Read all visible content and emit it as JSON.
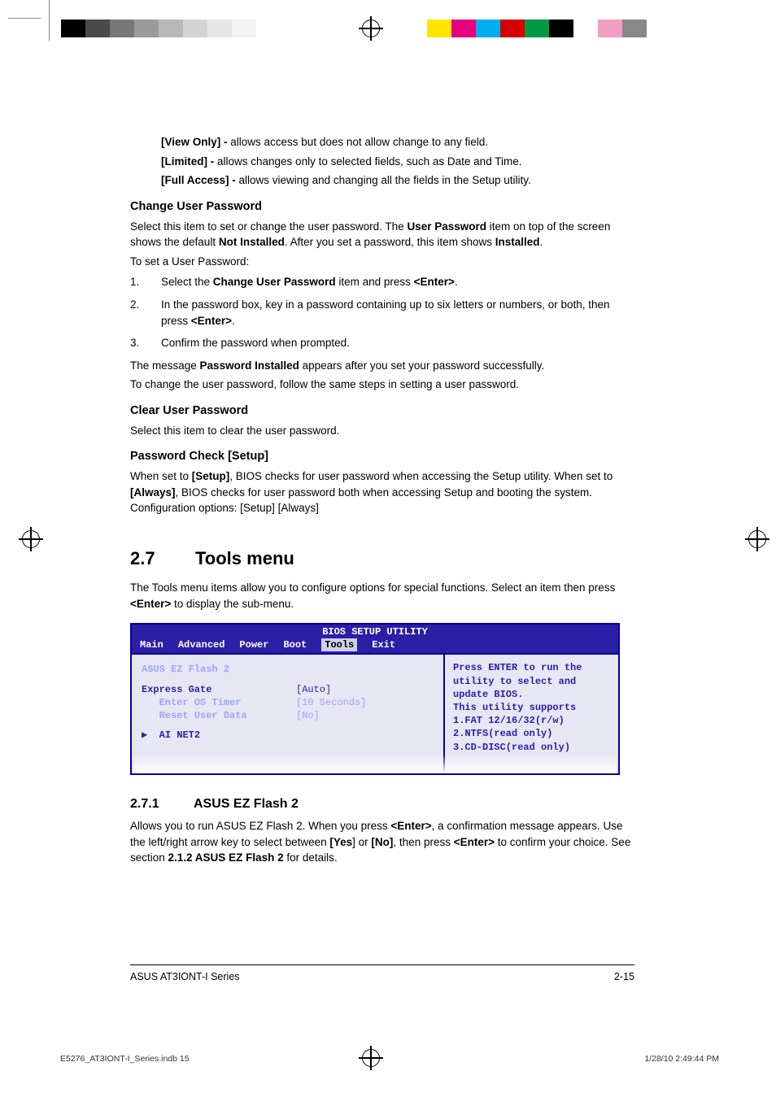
{
  "access_levels": [
    {
      "label": "[View Only] - ",
      "desc": "allows access but does not allow change to any field."
    },
    {
      "label": "[Limited] - ",
      "desc": "allows changes only to selected fields, such as Date and Time."
    },
    {
      "label": "[Full Access] - ",
      "desc": "allows viewing and changing all the fields in the Setup utility."
    }
  ],
  "change_pw": {
    "heading": "Change User Password",
    "p1a": "Select this item to set or change the user password. The ",
    "p1b": "User Password",
    "p1c": " item on top of the screen shows the default ",
    "p1d": "Not Installed",
    "p1e": ". After you set a password, this item shows ",
    "p1f": "Installed",
    "p1g": ".",
    "p2": "To set a User Password:",
    "steps": [
      {
        "n": "1.",
        "pre": "Select the ",
        "b1": "Change User Password",
        "mid": " item and press ",
        "b2": "<Enter>",
        "post": "."
      },
      {
        "n": "2.",
        "pre": "In the password box, key in a password containing up to six letters or numbers, or both, then press ",
        "b1": "<Enter>",
        "mid": "",
        "b2": "",
        "post": "."
      },
      {
        "n": "3.",
        "pre": "Confirm the password when prompted.",
        "b1": "",
        "mid": "",
        "b2": "",
        "post": ""
      }
    ],
    "p3a": "The message ",
    "p3b": "Password Installed",
    "p3c": " appears after you set your password successfully.",
    "p4": "To change the user password, follow the same steps in setting a user password."
  },
  "clear_pw": {
    "heading": "Clear User Password",
    "p1": "Select this item to clear the user password."
  },
  "pw_check": {
    "heading": "Password Check [Setup]",
    "p1a": "When set to ",
    "p1b": "[Setup]",
    "p1c": ", BIOS checks for user password when accessing the Setup utility. When set to ",
    "p1d": "[Always]",
    "p1e": ", BIOS checks for user password both when accessing Setup and booting the system. Configuration options: [Setup] [Always]"
  },
  "section": {
    "num": "2.7",
    "title": "Tools menu",
    "intro_a": "The Tools menu items allow you to configure options for special functions. Select an item then press ",
    "intro_b": "<Enter>",
    "intro_c": " to display the sub-menu."
  },
  "bios": {
    "title": "BIOS SETUP UTILITY",
    "menus": [
      "Main",
      "Advanced",
      "Power",
      "Boot",
      "Tools",
      "Exit"
    ],
    "selected": "Tools",
    "left": {
      "line1": "ASUS EZ Flash 2",
      "rows": [
        {
          "lbl": "Express Gate",
          "val": "[Auto]"
        },
        {
          "lbl": "   Enter OS Timer",
          "val": "[10 Seconds]"
        },
        {
          "lbl": "   Reset User Data",
          "val": "[No]"
        }
      ],
      "submenu": "AI NET2"
    },
    "right": "Press ENTER to run the utility to select and update BIOS.\nThis utility supports\n1.FAT 12/16/32(r/w)\n2.NTFS(read only)\n3.CD-DISC(read only)"
  },
  "subsection": {
    "num": "2.7.1",
    "title": "ASUS EZ Flash 2",
    "p_a": "Allows you to run ASUS EZ Flash 2. When you press ",
    "p_b": "<Enter>",
    "p_c": ", a confirmation message appears. Use the left/right arrow key to select between ",
    "p_d": "[Yes",
    "p_e": "] or ",
    "p_f": "[No]",
    "p_g": ", then press ",
    "p_h": "<Enter>",
    "p_i": " to confirm your choice. See section ",
    "p_j": "2.1.2 ASUS EZ Flash 2",
    "p_k": " for details."
  },
  "footer": {
    "left": "ASUS AT3IONT-I Series",
    "right": "2-15"
  },
  "print": {
    "file": "E5276_AT3IONT-I_Series.indb   15",
    "stamp": "1/28/10   2:49:44 PM"
  },
  "colors": {
    "left_swatches": [
      "#000",
      "#4a4a4a",
      "#777",
      "#9b9b9b",
      "#b8b8b8",
      "#d4d4d4",
      "#e6e6e6",
      "#f3f3f3",
      "#fff",
      "#fff"
    ],
    "right_swatches": [
      "#ffe600",
      "#e4007f",
      "#00aeef",
      "#d40000",
      "#009944",
      "#000",
      "#fff",
      "#f19ec2",
      "#888",
      "#fff"
    ]
  }
}
